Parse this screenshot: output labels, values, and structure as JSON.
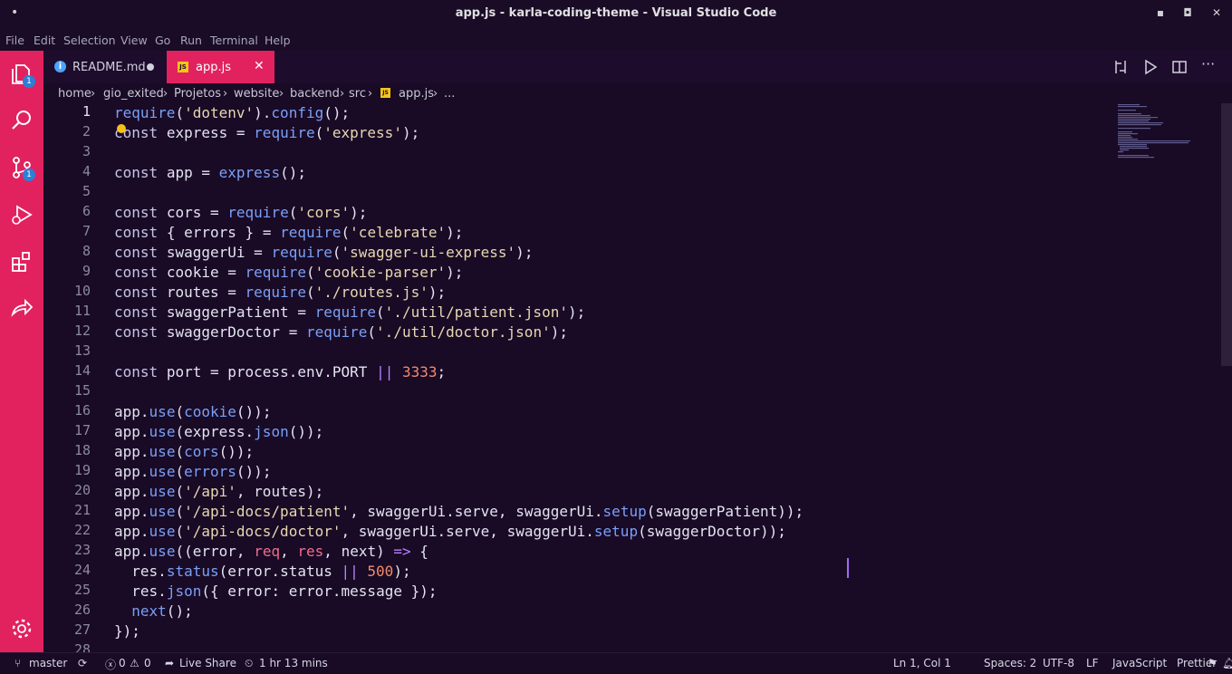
{
  "window": {
    "title": "app.js - karla-coding-theme - Visual Studio Code",
    "minimize_glyph": "▪",
    "maximize_glyph": "◘",
    "close_glyph": "✕"
  },
  "menu": {
    "items": [
      "File",
      "Edit",
      "Selection",
      "View",
      "Go",
      "Run",
      "Terminal",
      "Help"
    ]
  },
  "activity_bar": {
    "explorer_badge": "1",
    "source_control_badge": "1",
    "accent_color": "#e2225f"
  },
  "tabs": [
    {
      "label": "README.md",
      "icon": "info-icon",
      "modified": true,
      "active": false
    },
    {
      "label": "app.js",
      "icon": "js-file-icon",
      "modified": false,
      "active": true
    }
  ],
  "breadcrumb": [
    "home",
    "gio_exited",
    "Projetos",
    "website",
    "backend",
    "src",
    "app.js",
    "..."
  ],
  "editor": {
    "line_numbers": [
      "1",
      "2",
      "3",
      "4",
      "5",
      "6",
      "7",
      "8",
      "9",
      "10",
      "11",
      "12",
      "13",
      "14",
      "15",
      "16",
      "17",
      "18",
      "19",
      "20",
      "21",
      "22",
      "23",
      "24",
      "25",
      "26",
      "27",
      "28"
    ],
    "lines": [
      "require('dotenv').config();",
      "const express = require('express');",
      "",
      "const app = express();",
      "",
      "const cors = require('cors');",
      "const { errors } = require('celebrate');",
      "const swaggerUi = require('swagger-ui-express');",
      "const cookie = require('cookie-parser');",
      "const routes = require('./routes.js');",
      "const swaggerPatient = require('./util/patient.json');",
      "const swaggerDoctor = require('./util/doctor.json');",
      "",
      "const port = process.env.PORT || 3333;",
      "",
      "app.use(cookie());",
      "app.use(express.json());",
      "app.use(cors());",
      "app.use(errors());",
      "app.use('/api', routes);",
      "app.use('/api-docs/patient', swaggerUi.serve, swaggerUi.setup(swaggerPatient));",
      "app.use('/api-docs/doctor', swaggerUi.serve, swaggerUi.setup(swaggerDoctor));",
      "app.use((error, req, res, next) => {",
      "  res.status(error.status || 500);",
      "  res.json({ error: error.message });",
      "  next();",
      "});",
      ""
    ]
  },
  "statusbar": {
    "branch": "master",
    "errors": "0",
    "warnings": "0",
    "live_share": "Live Share",
    "time": "1 hr 13 mins",
    "position": "Ln 1, Col 1",
    "spaces": "Spaces: 2",
    "encoding": "UTF-8",
    "eol": "LF",
    "language": "JavaScript",
    "formatter": "Prettier"
  }
}
